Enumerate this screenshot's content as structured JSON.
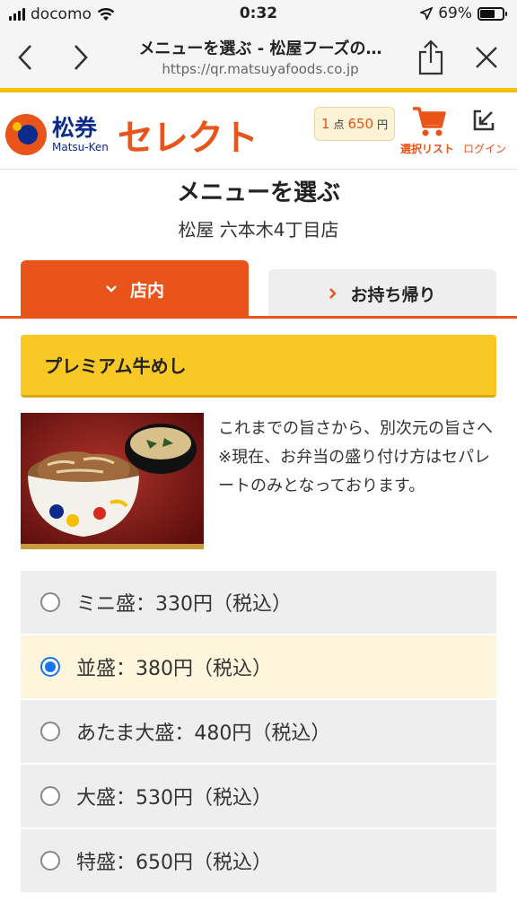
{
  "status_bar": {
    "carrier": "docomo",
    "time": "0:32",
    "battery": "69%",
    "battery_level": 0.69
  },
  "browser": {
    "title": "メニューを選ぶ - 松屋フーズの…",
    "url": "https://qr.matsuyafoods.co.jp"
  },
  "header": {
    "brand_jp": "松券",
    "brand_en": "Matsu-Ken",
    "brand_select": "セレクト",
    "cart_count": "1",
    "cart_unit": "点",
    "cart_price": "650",
    "cart_yen": "円",
    "cart_label": "選択リスト",
    "login_label": "ログイン"
  },
  "page": {
    "title": "メニューを選ぶ",
    "store": "松屋 六本木4丁目店"
  },
  "tabs": [
    {
      "label": "店内",
      "active": true
    },
    {
      "label": "お持ち帰り",
      "active": false
    }
  ],
  "category": {
    "title": "プレミアム牛めし"
  },
  "product": {
    "description": "これまでの旨さから、別次元の旨さへ　※現在、お弁当の盛り付け方はセパレートのみとなっております。"
  },
  "options": [
    {
      "label": "ミニ盛：330円（税込）",
      "selected": false
    },
    {
      "label": "並盛：380円（税込）",
      "selected": true
    },
    {
      "label": "あたま大盛：480円（税込）",
      "selected": false
    },
    {
      "label": "大盛：530円（税込）",
      "selected": false
    },
    {
      "label": "特盛：650円（税込）",
      "selected": false
    }
  ],
  "colors": {
    "accent": "#e8541a",
    "brand_blue": "#0a2a8c",
    "banner_yellow": "#f9c825"
  }
}
